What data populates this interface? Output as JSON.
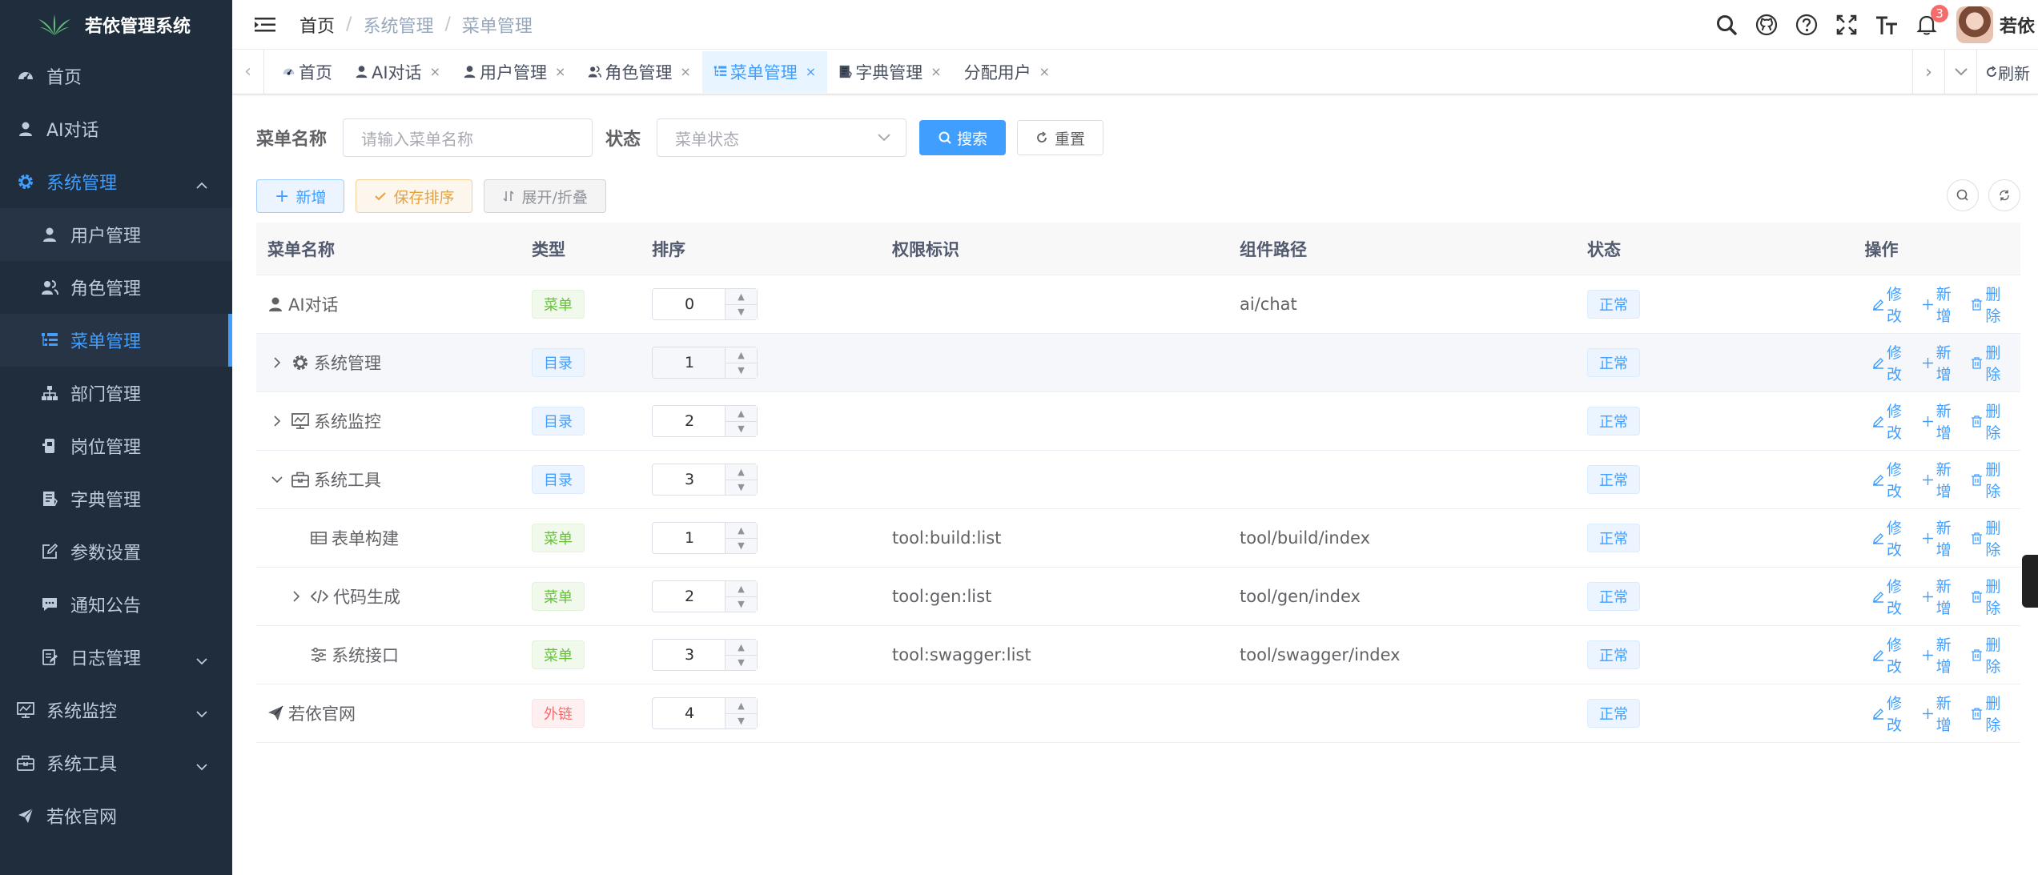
{
  "app": {
    "title": "若依管理系统"
  },
  "sidebar": {
    "items": [
      {
        "label": "首页",
        "icon": "dashboard-icon"
      },
      {
        "label": "AI对话",
        "icon": "user-icon"
      },
      {
        "label": "系统管理",
        "icon": "gear-icon",
        "expanded": true
      },
      {
        "label": "用户管理",
        "icon": "user-icon"
      },
      {
        "label": "角色管理",
        "icon": "peoples-icon"
      },
      {
        "label": "菜单管理",
        "icon": "tree-table-icon",
        "active": true
      },
      {
        "label": "部门管理",
        "icon": "tree-icon"
      },
      {
        "label": "岗位管理",
        "icon": "post-icon"
      },
      {
        "label": "字典管理",
        "icon": "dict-icon"
      },
      {
        "label": "参数设置",
        "icon": "edit-icon"
      },
      {
        "label": "通知公告",
        "icon": "message-icon"
      },
      {
        "label": "日志管理",
        "icon": "log-icon"
      },
      {
        "label": "系统监控",
        "icon": "monitor-icon"
      },
      {
        "label": "系统工具",
        "icon": "tool-icon"
      },
      {
        "label": "若依官网",
        "icon": "guide-icon"
      }
    ]
  },
  "breadcrumb": {
    "items": [
      "首页",
      "系统管理",
      "菜单管理"
    ]
  },
  "header": {
    "notification_count": "3",
    "user_name": "若依"
  },
  "tags": {
    "items": [
      {
        "label": "首页",
        "closable": false
      },
      {
        "label": "AI对话",
        "closable": true
      },
      {
        "label": "用户管理",
        "closable": true
      },
      {
        "label": "角色管理",
        "closable": true
      },
      {
        "label": "菜单管理",
        "closable": true,
        "active": true
      },
      {
        "label": "字典管理",
        "closable": true
      },
      {
        "label": "分配用户",
        "closable": true
      }
    ],
    "refresh_label": "刷新",
    "close_symbol": "×"
  },
  "search": {
    "menu_name_label": "菜单名称",
    "menu_name_placeholder": "请输入菜单名称",
    "status_label": "状态",
    "status_placeholder": "菜单状态",
    "search_button": "搜索",
    "reset_button": "重置"
  },
  "toolbar": {
    "add_label": "新增",
    "save_sort_label": "保存排序",
    "expand_label": "展开/折叠"
  },
  "table": {
    "headers": [
      "菜单名称",
      "类型",
      "排序",
      "权限标识",
      "组件路径",
      "状态",
      "操作"
    ],
    "op_labels": {
      "edit": "修改",
      "add": "新增",
      "delete": "删除"
    },
    "rows": [
      {
        "name": "AI对话",
        "icon": "user-icon",
        "type": "菜单",
        "type_kind": "green",
        "order": "0",
        "perm": "",
        "component": "ai/chat",
        "status": "正常",
        "level": 0,
        "expander": "none"
      },
      {
        "name": "系统管理",
        "icon": "gear-icon",
        "type": "目录",
        "type_kind": "blue",
        "order": "1",
        "perm": "",
        "component": "",
        "status": "正常",
        "level": 0,
        "expander": "right"
      },
      {
        "name": "系统监控",
        "icon": "monitor-icon",
        "type": "目录",
        "type_kind": "blue",
        "order": "2",
        "perm": "",
        "component": "",
        "status": "正常",
        "level": 0,
        "expander": "right"
      },
      {
        "name": "系统工具",
        "icon": "tool-icon",
        "type": "目录",
        "type_kind": "blue",
        "order": "3",
        "perm": "",
        "component": "",
        "status": "正常",
        "level": 0,
        "expander": "down"
      },
      {
        "name": "表单构建",
        "icon": "build-icon",
        "type": "菜单",
        "type_kind": "green",
        "order": "1",
        "perm": "tool:build:list",
        "component": "tool/build/index",
        "status": "正常",
        "level": 1,
        "expander": "none"
      },
      {
        "name": "代码生成",
        "icon": "code-icon",
        "type": "菜单",
        "type_kind": "green",
        "order": "2",
        "perm": "tool:gen:list",
        "component": "tool/gen/index",
        "status": "正常",
        "level": 1,
        "expander": "right"
      },
      {
        "name": "系统接口",
        "icon": "swagger-icon",
        "type": "菜单",
        "type_kind": "green",
        "order": "3",
        "perm": "tool:swagger:list",
        "component": "tool/swagger/index",
        "status": "正常",
        "level": 1,
        "expander": "none"
      },
      {
        "name": "若依官网",
        "icon": "guide-icon",
        "type": "外链",
        "type_kind": "red",
        "order": "4",
        "perm": "",
        "component": "",
        "status": "正常",
        "level": 0,
        "expander": "none"
      }
    ]
  },
  "colors": {
    "primary": "#409eff",
    "sidebar_bg": "#1f2d3d",
    "sidebar_text": "#bfcbd9",
    "success": "#67c23a",
    "warning": "#e6a23c",
    "danger": "#f56c6c"
  }
}
